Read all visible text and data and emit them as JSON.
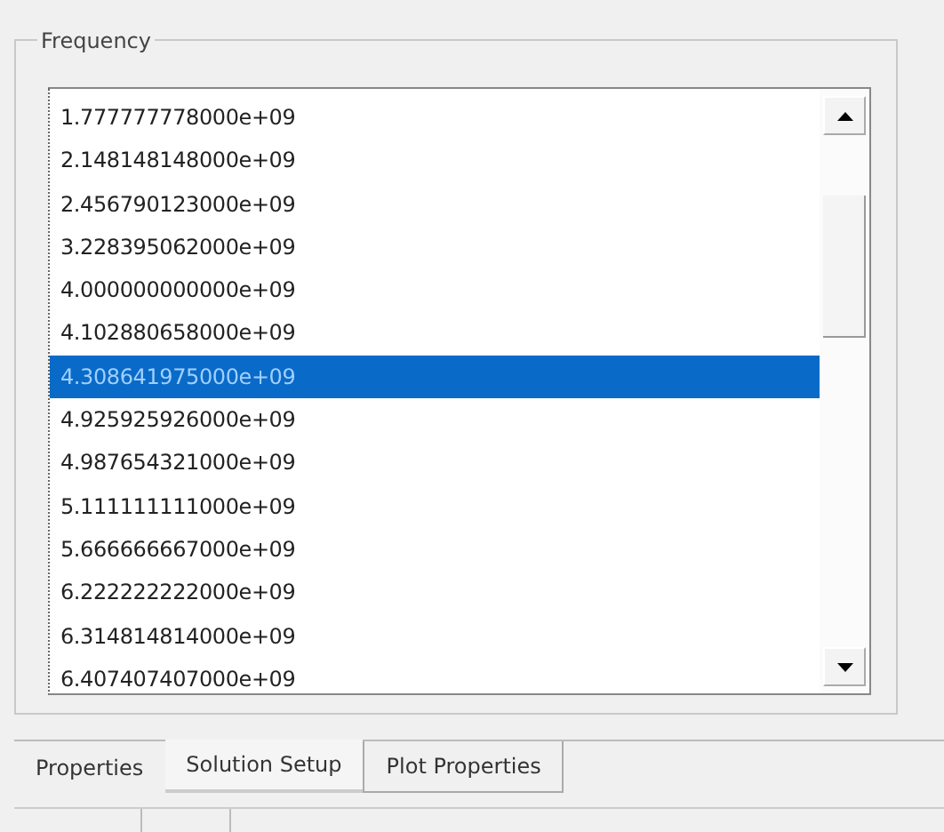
{
  "group": {
    "title": "Frequency"
  },
  "list": [
    {
      "text": "1.777777778000e+09",
      "selected": false
    },
    {
      "text": "2.148148148000e+09",
      "selected": false
    },
    {
      "text": "2.456790123000e+09",
      "selected": false
    },
    {
      "text": "3.228395062000e+09",
      "selected": false
    },
    {
      "text": "4.000000000000e+09",
      "selected": false
    },
    {
      "text": "4.102880658000e+09",
      "selected": false
    },
    {
      "text": "4.308641975000e+09",
      "selected": true
    },
    {
      "text": "4.925925926000e+09",
      "selected": false
    },
    {
      "text": "4.987654321000e+09",
      "selected": false
    },
    {
      "text": "5.111111111000e+09",
      "selected": false
    },
    {
      "text": "5.666666667000e+09",
      "selected": false
    },
    {
      "text": "6.222222222000e+09",
      "selected": false
    },
    {
      "text": "6.314814814000e+09",
      "selected": false
    },
    {
      "text": "6.407407407000e+09",
      "selected": false
    }
  ],
  "tabs": [
    {
      "label": "Properties",
      "selected": false
    },
    {
      "label": "Solution Setup",
      "selected": true
    },
    {
      "label": "Plot Properties",
      "selected": false
    }
  ]
}
